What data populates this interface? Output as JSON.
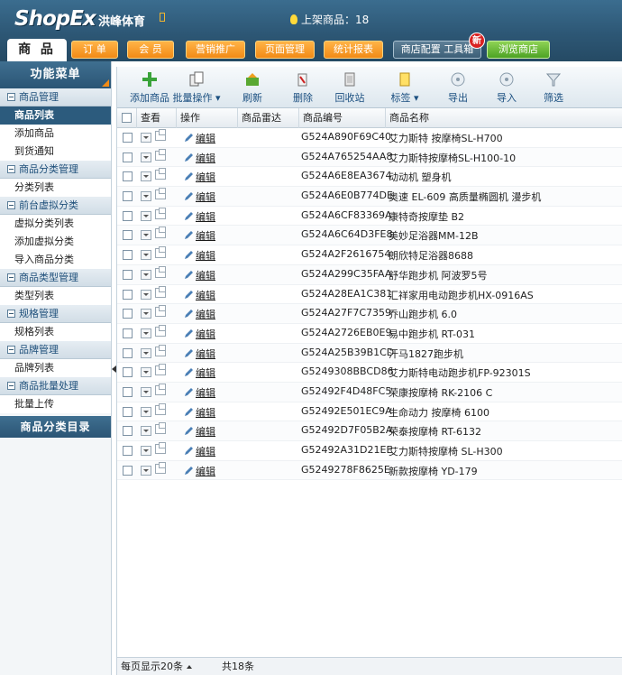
{
  "header": {
    "logo": "ShopEx",
    "site_name": "洪峰体育",
    "onsale_text": "上架商品：18",
    "main_tab": "商 品",
    "nav": [
      {
        "label": "订 单"
      },
      {
        "label": "会 员"
      },
      {
        "label": "营销推广"
      },
      {
        "label": "页面管理"
      },
      {
        "label": "统计报表"
      },
      {
        "label": "商店配置  工具箱"
      },
      {
        "label": "浏览商店"
      }
    ],
    "new_badge": "新"
  },
  "sidebar": {
    "title": "功能菜单",
    "groups": [
      {
        "title": "商品管理",
        "items": [
          "商品列表",
          "添加商品",
          "到货通知"
        ]
      },
      {
        "title": "商品分类管理",
        "items": [
          "分类列表"
        ]
      },
      {
        "title": "前台虚拟分类",
        "items": [
          "虚拟分类列表",
          "添加虚拟分类",
          "导入商品分类"
        ]
      },
      {
        "title": "商品类型管理",
        "items": [
          "类型列表"
        ]
      },
      {
        "title": "规格管理",
        "items": [
          "规格列表"
        ]
      },
      {
        "title": "品牌管理",
        "items": [
          "品牌列表"
        ]
      },
      {
        "title": "商品批量处理",
        "items": [
          "批量上传"
        ]
      }
    ],
    "catalog": "商品分类目录"
  },
  "toolbar": {
    "items": [
      {
        "label": "添加商品",
        "icon": "plus-icon"
      },
      {
        "label": "批量操作 ▾",
        "icon": "batch-icon"
      },
      {
        "label": "刷新",
        "icon": "refresh-icon"
      },
      {
        "label": "删除",
        "icon": "trash-icon"
      },
      {
        "label": "回收站",
        "icon": "recycle-icon"
      },
      {
        "label": "标签 ▾",
        "icon": "tag-icon"
      },
      {
        "label": "导出",
        "icon": "export-icon"
      },
      {
        "label": "导入",
        "icon": "import-icon"
      },
      {
        "label": "筛选",
        "icon": "filter-icon"
      }
    ]
  },
  "grid": {
    "headers": [
      "查看",
      "操作",
      "商品雷达",
      "商品编号",
      "商品名称"
    ],
    "edit_label": "编辑",
    "rows": [
      {
        "code": "G524A890F69C40",
        "name": "艾力斯特 按摩椅SL-H700"
      },
      {
        "code": "G524A765254AA8",
        "name": "艾力斯特按摩椅SL-H100-10"
      },
      {
        "code": "G524A6E8EA3674",
        "name": "动动机 塑身机"
      },
      {
        "code": "G524A6E0B774DE",
        "name": "奥速 EL-609 高质量椭圆机 漫步机"
      },
      {
        "code": "G524A6CF83369A",
        "name": "康特奇按摩垫 B2"
      },
      {
        "code": "G524A6C64D3FE8",
        "name": "美妙足浴器MM-12B"
      },
      {
        "code": "G524A2F2616754",
        "name": "朗欣特足浴器8688"
      },
      {
        "code": "G524A299C35FAA",
        "name": "舒华跑步机 阿波罗5号"
      },
      {
        "code": "G524A28EA1C381",
        "name": "汇祥家用电动跑步机HX-0916AS"
      },
      {
        "code": "G524A27F7C7359",
        "name": "乔山跑步机 6.0"
      },
      {
        "code": "G524A2726EB0E9",
        "name": "易中跑步机 RT-031"
      },
      {
        "code": "G524A25B39B1CD",
        "name": "汗马1827跑步机"
      },
      {
        "code": "G5249308BBCD86",
        "name": "艾力斯特电动跑步机FP-92301S"
      },
      {
        "code": "G52492F4D48FC5",
        "name": "荣康按摩椅 RK-2106 C"
      },
      {
        "code": "G52492E501EC9A",
        "name": "生命动力 按摩椅 6100"
      },
      {
        "code": "G52492D7F05B2A",
        "name": "荣泰按摩椅 RT-6132"
      },
      {
        "code": "G52492A31D21EE",
        "name": "艾力斯特按摩椅 SL-H300"
      },
      {
        "code": "G5249278F8625E",
        "name": "新款按摩椅 YD-179"
      }
    ]
  },
  "footer": {
    "per_page": "每页显示20条",
    "total": "共18条"
  }
}
